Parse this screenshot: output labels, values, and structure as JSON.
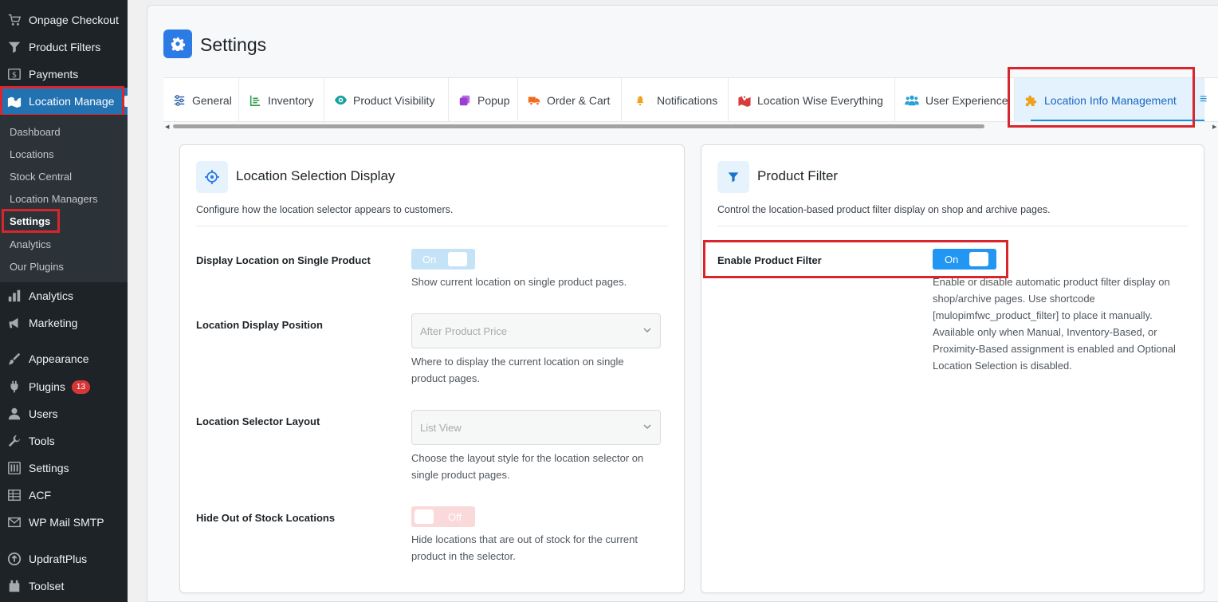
{
  "sidebar": {
    "items": [
      {
        "label": "Onpage Checkout",
        "icon": "cart-icon"
      },
      {
        "label": "Product Filters",
        "icon": "filter-icon"
      },
      {
        "label": "Payments",
        "icon": "dollar-icon"
      },
      {
        "label": "Location Manage",
        "icon": "map-icon"
      },
      {
        "label": "Analytics",
        "icon": "bar-chart-icon"
      },
      {
        "label": "Marketing",
        "icon": "megaphone-icon"
      },
      {
        "label": "Appearance",
        "icon": "paintbrush-icon"
      },
      {
        "label": "Plugins",
        "icon": "plugin-icon",
        "badge": "13"
      },
      {
        "label": "Users",
        "icon": "user-icon"
      },
      {
        "label": "Tools",
        "icon": "wrench-icon"
      },
      {
        "label": "Settings",
        "icon": "sliders-icon"
      },
      {
        "label": "ACF",
        "icon": "table-icon"
      },
      {
        "label": "WP Mail SMTP",
        "icon": "mail-icon"
      },
      {
        "label": "UpdraftPlus",
        "icon": "updraft-icon"
      },
      {
        "label": "Toolset",
        "icon": "toolset-icon"
      }
    ],
    "submenu": [
      "Dashboard",
      "Locations",
      "Stock Central",
      "Location Managers",
      "Settings",
      "Analytics",
      "Our Plugins"
    ]
  },
  "page": {
    "title": "Settings"
  },
  "tabs": [
    {
      "label": "General",
      "icon": "sliders-icon",
      "color": "#2c5fa8"
    },
    {
      "label": "Inventory",
      "icon": "list-icon",
      "color": "#2e9e4f"
    },
    {
      "label": "Product Visibility",
      "icon": "eye-icon",
      "color": "#17a2a0"
    },
    {
      "label": "Popup",
      "icon": "popup-icon",
      "color": "#9b3fd1"
    },
    {
      "label": "Order & Cart",
      "icon": "truck-icon",
      "color": "#f06a1c"
    },
    {
      "label": "Notifications",
      "icon": "bell-icon",
      "color": "#f0a11c"
    },
    {
      "label": "Location Wise Everything",
      "icon": "map-marker-icon",
      "color": "#d83b3b"
    },
    {
      "label": "User Experience",
      "icon": "users-icon",
      "color": "#2b9fd6"
    },
    {
      "label": "Location Info Management",
      "icon": "puzzle-icon",
      "color": "#f0a11c"
    }
  ],
  "location_panel": {
    "title": "Location Selection Display",
    "description": "Configure how the location selector appears to customers.",
    "fields": {
      "display_single": {
        "label": "Display Location on Single Product",
        "toggle": "On",
        "help": "Show current location on single product pages."
      },
      "display_position": {
        "label": "Location Display Position",
        "value": "After Product Price",
        "help": "Where to display the current location on single product pages."
      },
      "selector_layout": {
        "label": "Location Selector Layout",
        "value": "List View",
        "help": "Choose the layout style for the location selector on single product pages."
      },
      "hide_out_of_stock": {
        "label": "Hide Out of Stock Locations",
        "toggle": "Off",
        "help": "Hide locations that are out of stock for the current product in the selector."
      }
    }
  },
  "filter_panel": {
    "title": "Product Filter",
    "description": "Control the location-based product filter display on shop and archive pages.",
    "enable": {
      "label": "Enable Product Filter",
      "toggle": "On",
      "help": "Enable or disable automatic product filter display on shop/archive pages. Use shortcode [mulopimfwc_product_filter] to place it manually. Available only when Manual, Inventory-Based, or Proximity-Based assignment is enabled and Optional Location Selection is disabled."
    }
  },
  "colors": {
    "sidebar_bg": "#1d2327",
    "submenu_bg": "#2c3338",
    "accent": "#2271b1",
    "highlight_box": "#d9262d",
    "toggle_on": "#2196f3"
  }
}
